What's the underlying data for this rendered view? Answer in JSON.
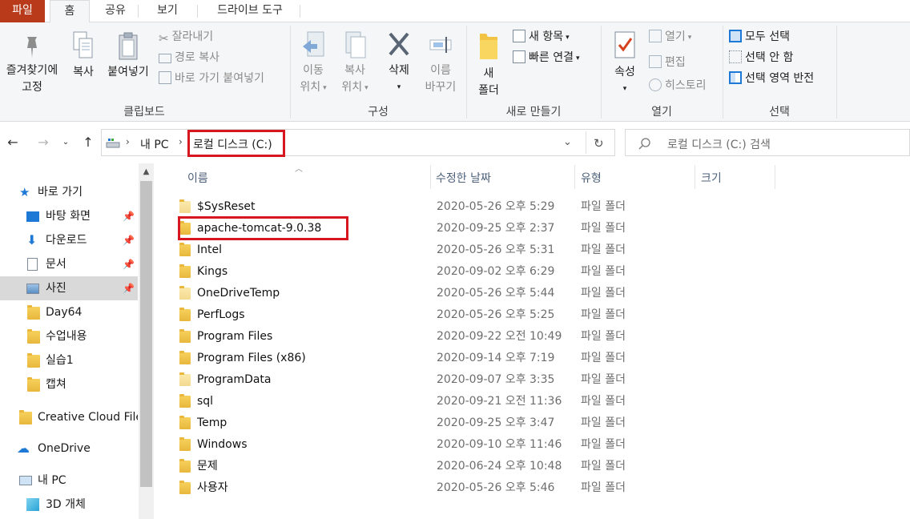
{
  "tabs": [
    "파일",
    "홈",
    "공유",
    "보기",
    "드라이브 도구"
  ],
  "ribbon": {
    "clipboard": {
      "pin_line1": "즐겨찾기에",
      "pin_line2": "고정",
      "copy": "복사",
      "paste": "붙여넣기",
      "cut": "잘라내기",
      "copy_path": "경로 복사",
      "paste_shortcut": "바로 가기 붙여넣기",
      "group": "클립보드"
    },
    "organize": {
      "move_line1": "이동",
      "move_line2": "위치",
      "copy_line1": "복사",
      "copy_line2": "위치",
      "delete": "삭제",
      "rename_line1": "이름",
      "rename_line2": "바꾸기",
      "group": "구성"
    },
    "new": {
      "folder_line1": "새",
      "folder_line2": "폴더",
      "new_item": "새 항목",
      "easy_access": "빠른 연결",
      "group": "새로 만들기"
    },
    "open": {
      "properties": "속성",
      "open": "열기",
      "edit": "편집",
      "history": "히스토리",
      "group": "열기"
    },
    "select": {
      "select_all": "모두 선택",
      "select_none": "선택 안 함",
      "invert": "선택 영역 반전",
      "group": "선택"
    }
  },
  "address": {
    "crumb_pc": "내 PC",
    "crumb_disk": "로컬 디스크 (C:)",
    "search_placeholder": "로컬 디스크 (C:) 검색"
  },
  "sidebar": {
    "quick_access": "바로 가기",
    "items": [
      "바탕 화면",
      "다운로드",
      "문서",
      "사진",
      "Day64",
      "수업내용",
      "실습1",
      "캡쳐"
    ],
    "creative_cloud": "Creative Cloud Files",
    "onedrive": "OneDrive",
    "this_pc": "내 PC",
    "objects3d": "3D 개체"
  },
  "columns": {
    "name": "이름",
    "date": "수정한 날짜",
    "type": "유형",
    "size": "크기"
  },
  "files": [
    {
      "name": "$SysReset",
      "date": "2020-05-26 오후 5:29",
      "type": "파일 폴더",
      "faint": true
    },
    {
      "name": "apache-tomcat-9.0.38",
      "date": "2020-09-25 오후 2:37",
      "type": "파일 폴더",
      "faint": false
    },
    {
      "name": "Intel",
      "date": "2020-05-26 오후 5:31",
      "type": "파일 폴더",
      "faint": false
    },
    {
      "name": "Kings",
      "date": "2020-09-02 오후 6:29",
      "type": "파일 폴더",
      "faint": false
    },
    {
      "name": "OneDriveTemp",
      "date": "2020-05-26 오후 5:44",
      "type": "파일 폴더",
      "faint": true
    },
    {
      "name": "PerfLogs",
      "date": "2020-05-26 오후 5:25",
      "type": "파일 폴더",
      "faint": false
    },
    {
      "name": "Program Files",
      "date": "2020-09-22 오전 10:49",
      "type": "파일 폴더",
      "faint": false
    },
    {
      "name": "Program Files (x86)",
      "date": "2020-09-14 오후 7:19",
      "type": "파일 폴더",
      "faint": false
    },
    {
      "name": "ProgramData",
      "date": "2020-09-07 오후 3:35",
      "type": "파일 폴더",
      "faint": true
    },
    {
      "name": "sql",
      "date": "2020-09-21 오전 11:36",
      "type": "파일 폴더",
      "faint": false
    },
    {
      "name": "Temp",
      "date": "2020-09-25 오후 3:47",
      "type": "파일 폴더",
      "faint": false
    },
    {
      "name": "Windows",
      "date": "2020-09-10 오후 11:46",
      "type": "파일 폴더",
      "faint": false
    },
    {
      "name": "문제",
      "date": "2020-06-24 오후 10:48",
      "type": "파일 폴더",
      "faint": false
    },
    {
      "name": "사용자",
      "date": "2020-05-26 오후 5:46",
      "type": "파일 폴더",
      "faint": false
    }
  ],
  "colors": {
    "file_tab": "#b83a1b",
    "highlight": "#d6171f",
    "accent_blue": "#1e78d6"
  }
}
